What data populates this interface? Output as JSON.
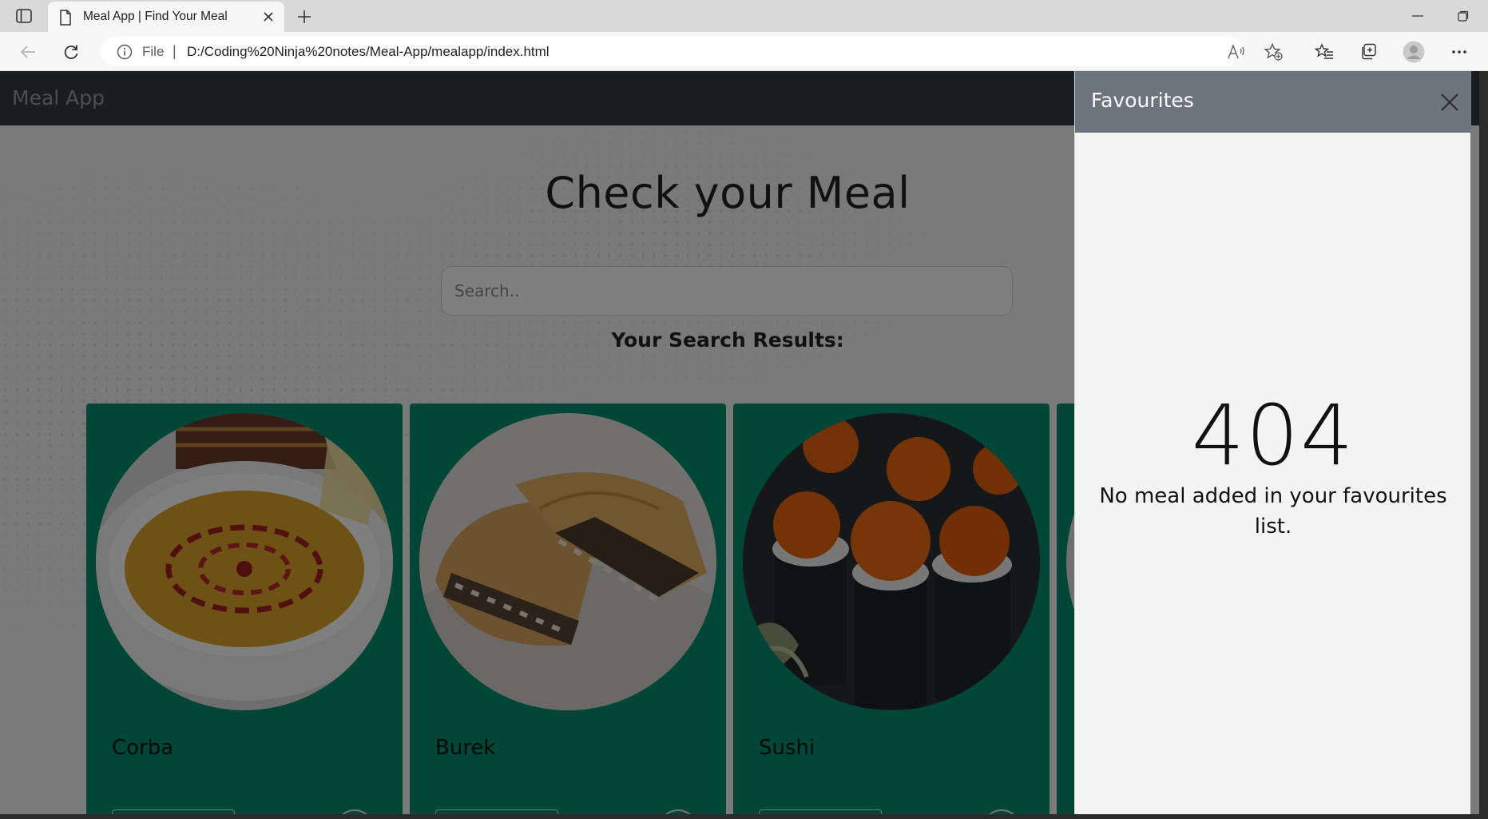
{
  "browser": {
    "tab_title": "Meal App | Find Your Meal",
    "address_scheme": "File",
    "address_separator": "|",
    "url": "D:/Coding%20Ninja%20notes/Meal-App/mealapp/index.html",
    "icons": {
      "tab_actions": "tab-actions-icon",
      "page": "page-icon",
      "tab_close": "close-icon",
      "new_tab": "plus-icon",
      "minimize": "minimize-icon",
      "restore": "restore-icon",
      "back": "back-arrow-icon",
      "reload": "reload-icon",
      "info": "info-icon",
      "read_aloud": "read-aloud-icon",
      "add_favorite": "star-plus-icon",
      "favorites": "favorites-icon",
      "collections": "collections-icon",
      "profile": "profile-icon",
      "more": "more-icon"
    }
  },
  "app": {
    "brand": "Meal App",
    "heading": "Check your Meal",
    "search": {
      "placeholder": "Search..",
      "value": ""
    },
    "results_heading": "Your Search Results:",
    "meals": [
      {
        "name": "Corba"
      },
      {
        "name": "Burek"
      },
      {
        "name": "Sushi"
      }
    ],
    "colors": {
      "navbar": "#343a40",
      "card": "#008c6e",
      "favourites_header": "#6c757d"
    }
  },
  "favourites": {
    "title": "Favourites",
    "error_code": "404",
    "message": "No meal added in your favourites list."
  }
}
